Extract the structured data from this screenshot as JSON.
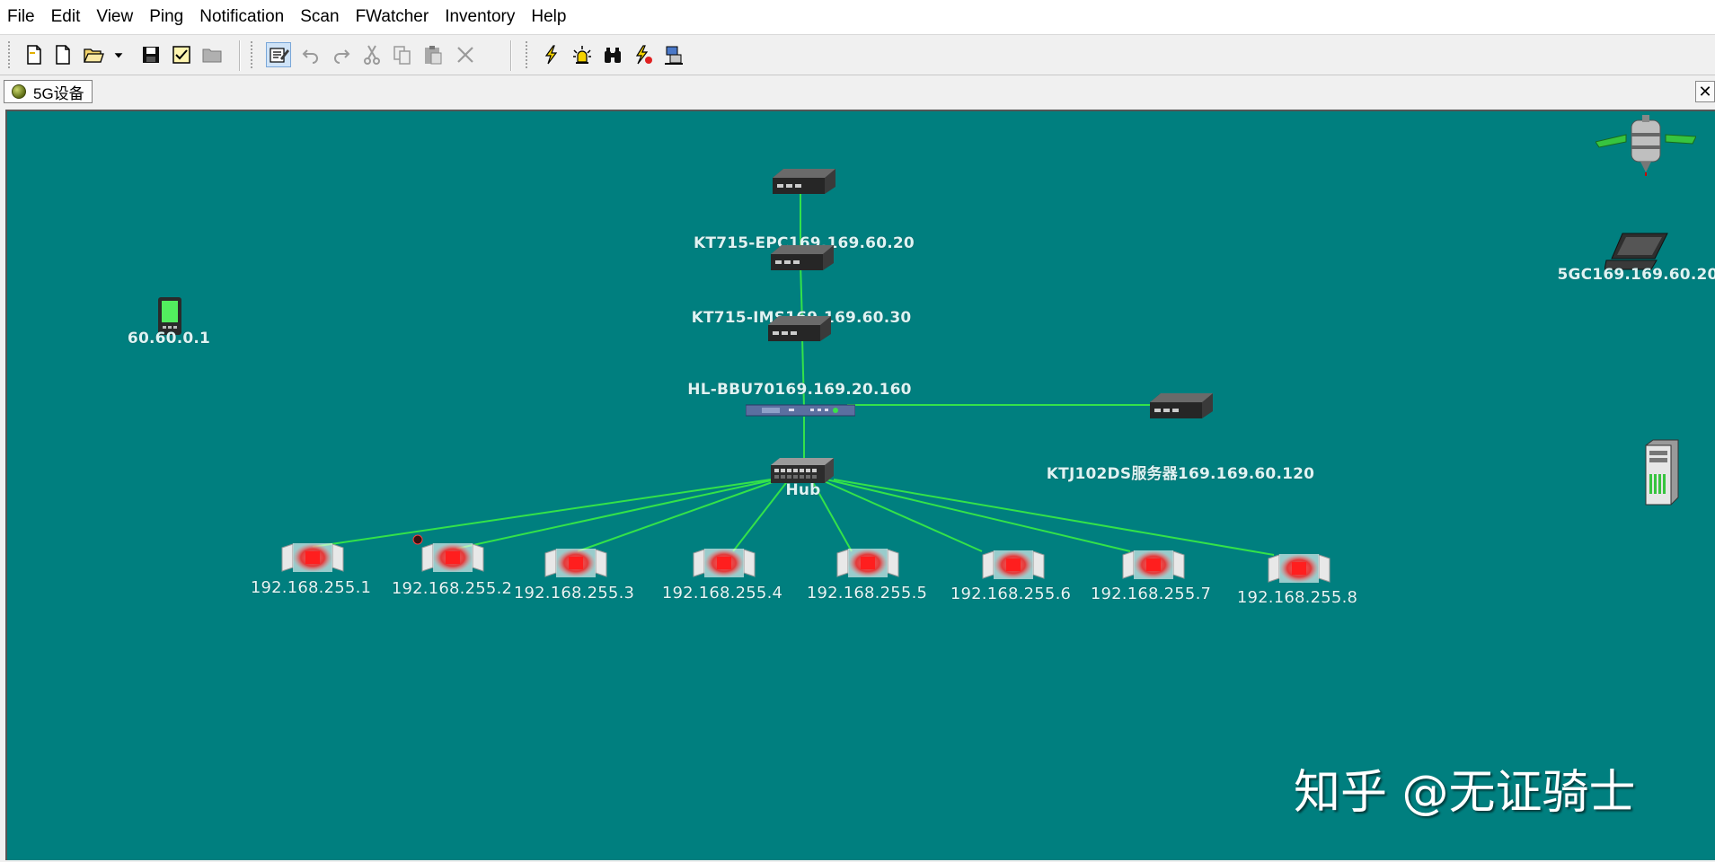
{
  "menu": {
    "items": [
      "File",
      "Edit",
      "View",
      "Ping",
      "Notification",
      "Scan",
      "FWatcher",
      "Inventory",
      "Help"
    ]
  },
  "toolbar": {
    "buttons": [
      "new-map-icon",
      "new-file-icon",
      "open-folder-icon",
      "dropdown-arrow-icon",
      "save-icon",
      "check-document-icon",
      "folder-icon",
      "edit-mode-icon",
      "undo-icon",
      "redo-icon",
      "cut-icon",
      "copy-icon",
      "paste-icon",
      "delete-icon",
      "lightning-icon",
      "alarm-light-icon",
      "binoculars-icon",
      "flash-scan-icon",
      "network-pc-icon"
    ]
  },
  "tab": {
    "label": "5G设备",
    "close": "✕"
  },
  "colors": {
    "canvas": "#007f7f",
    "link": "#33e24a",
    "label": "#dff3f3"
  },
  "nodes": {
    "epc": "KT715-EPC169.169.60.20",
    "ims": "KT715-IMS169.169.60.30",
    "bbu": "HL-BBU70169.169.20.160",
    "server": "KTJ102DS服务器169.169.60.120",
    "hub": "Hub",
    "phone": "60.60.0.1",
    "laptop": "5GC169.169.60.20",
    "leaves": [
      "192.168.255.1",
      "192.168.255.2",
      "192.168.255.3",
      "192.168.255.4",
      "192.168.255.5",
      "192.168.255.6",
      "192.168.255.7",
      "192.168.255.8"
    ]
  },
  "watermark": "知乎 @无证骑士"
}
